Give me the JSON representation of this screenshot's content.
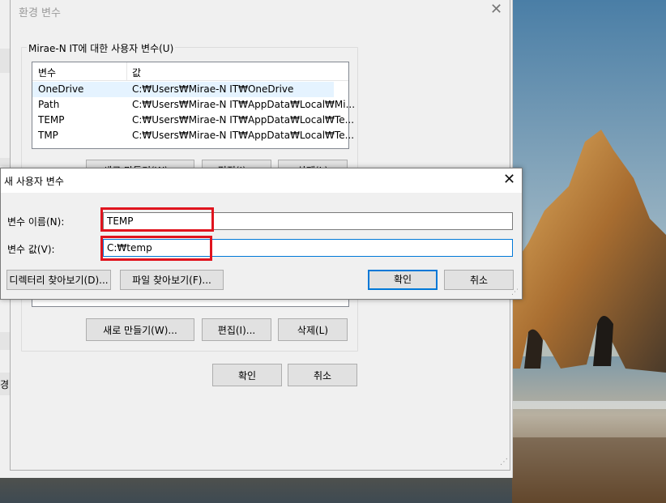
{
  "env_window": {
    "title": "환경 변수",
    "user_vars_group": "Mirae-N IT에 대한 사용자 변수(U)",
    "columns": [
      "변수",
      "값"
    ],
    "rows": [
      {
        "name": "OneDrive",
        "value": "C:₩Users₩Mirae-N IT₩OneDrive"
      },
      {
        "name": "Path",
        "value": "C:₩Users₩Mirae-N IT₩AppData₩Local₩Mi..."
      },
      {
        "name": "TEMP",
        "value": "C:₩Users₩Mirae-N IT₩AppData₩Local₩Te..."
      },
      {
        "name": "TMP",
        "value": "C:₩Users₩Mirae-N IT₩AppData₩Local₩Te..."
      }
    ],
    "buttons": {
      "new": "새로 만들기(W)...",
      "edit": "편집(I)...",
      "delete": "삭제(L)",
      "ok": "확인",
      "cancel": "취소"
    },
    "partial_label": "경"
  },
  "new_var_dialog": {
    "title": "새 사용자 변수",
    "name_label": "변수 이름(N):",
    "name_value": "TEMP",
    "value_label": "변수 값(V):",
    "value_value": "C:₩temp",
    "browse_dir": "디렉터리 찾아보기(D)...",
    "browse_file": "파일 찾아보기(F)...",
    "ok": "확인",
    "cancel": "취소"
  },
  "colors": {
    "highlight": "#e0141e",
    "focus": "#0078d7",
    "selection": "#e5f3ff"
  }
}
